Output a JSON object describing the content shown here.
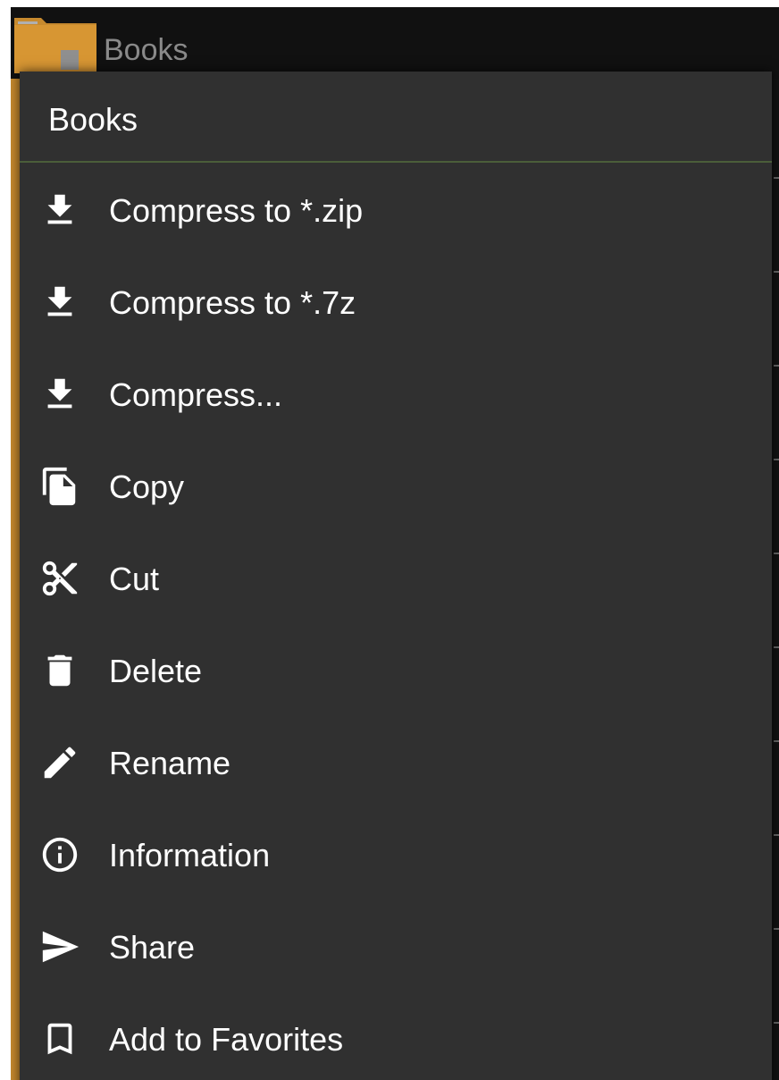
{
  "header": {
    "folder_name": "Books",
    "folder_icon": "folder-icon"
  },
  "menu": {
    "title": "Books",
    "items": [
      {
        "label": "Compress to *.zip",
        "icon": "download-icon"
      },
      {
        "label": "Compress to *.7z",
        "icon": "download-icon"
      },
      {
        "label": "Compress...",
        "icon": "download-icon"
      },
      {
        "label": "Copy",
        "icon": "copy-icon"
      },
      {
        "label": "Cut",
        "icon": "scissors-icon"
      },
      {
        "label": "Delete",
        "icon": "trash-icon"
      },
      {
        "label": "Rename",
        "icon": "pencil-icon"
      },
      {
        "label": "Information",
        "icon": "info-icon"
      },
      {
        "label": "Share",
        "icon": "send-icon"
      },
      {
        "label": "Add to Favorites",
        "icon": "bookmark-icon"
      }
    ]
  },
  "colors": {
    "menu_background": "#303030",
    "divider": "#4b5e3a",
    "text": "#ffffff",
    "folder": "#c78a2e"
  }
}
